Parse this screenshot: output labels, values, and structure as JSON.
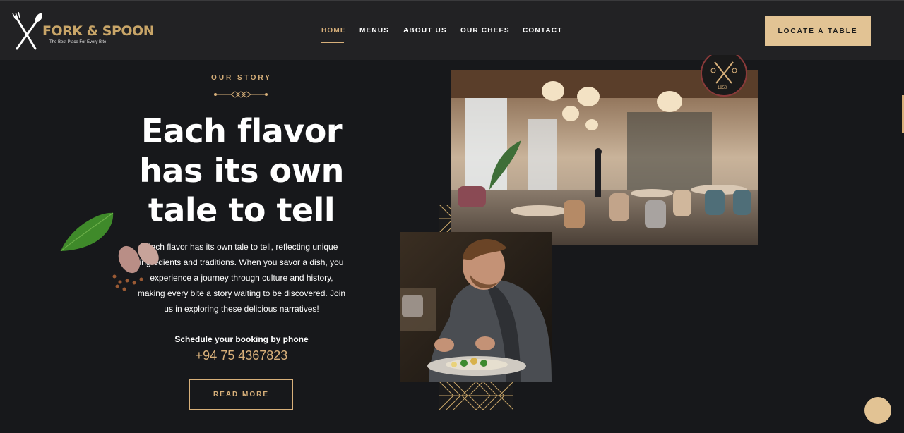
{
  "header": {
    "logo_text": "FORK & SPOON",
    "logo_tagline": "The Best Place For Every Bite",
    "nav": [
      {
        "label": "HOME",
        "active": true
      },
      {
        "label": "MENUS",
        "active": false
      },
      {
        "label": "ABOUT US",
        "active": false
      },
      {
        "label": "OUR CHEFS",
        "active": false
      },
      {
        "label": "CONTACT",
        "active": false
      }
    ],
    "cta_label": "LOCATE A TABLE"
  },
  "story": {
    "eyebrow": "OUR STORY",
    "headline_lines": [
      "Each flavor",
      "has its own",
      "tale to tell"
    ],
    "body": "Each flavor has its own tale to tell, reflecting unique ingredients and traditions. When you savor a dish, you experience a journey through culture and history, making every bite a story waiting to be discovered. Join us in exploring these delicious narratives!",
    "booking_label": "Schedule your booking by phone",
    "phone": "+94 75 4367823",
    "button_label": "READ MORE"
  },
  "emblem": {
    "year": "1950"
  },
  "colors": {
    "background": "#17181b",
    "header": "#222224",
    "accent": "#d8b07a",
    "button_fill": "#e2c394"
  },
  "icons": {
    "logo": "fork-spoon-icon",
    "divider": "ornament-divider-icon",
    "chat": "chat-bubble-icon"
  }
}
